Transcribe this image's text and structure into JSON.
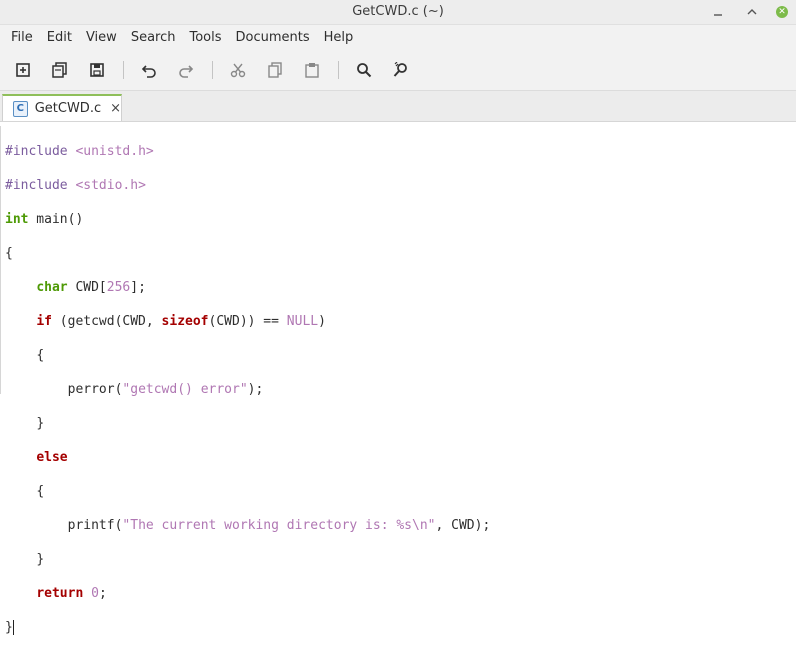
{
  "window": {
    "title": "GetCWD.c (~)"
  },
  "menu": [
    "File",
    "Edit",
    "View",
    "Search",
    "Tools",
    "Documents",
    "Help"
  ],
  "toolbar": {
    "buttons": [
      "new-document",
      "open-document",
      "save",
      "undo",
      "redo",
      "cut",
      "copy",
      "paste",
      "find",
      "find-replace"
    ]
  },
  "tab": {
    "label": "GetCWD.c",
    "icon": "C",
    "close": "×"
  },
  "code": {
    "include1_kw": "#include",
    "include1_val": "<unistd.h>",
    "include2_kw": "#include",
    "include2_val": "<stdio.h>",
    "main_type": "int",
    "main_rest": " main()",
    "open_brace": "{",
    "char_kw": "char",
    "cwd_decl": " CWD[",
    "size": "256",
    "cwd_end": "];",
    "if_kw": "if",
    "if_mid": " (getcwd(CWD, ",
    "sizeof_kw": "sizeof",
    "if_cmp": "(CWD)) == ",
    "null": "NULL",
    "if_end": ")",
    "inner_open1": "{",
    "perror_call": "perror(",
    "perror_str": "\"getcwd() error\"",
    "perror_end": ");",
    "inner_close1": "}",
    "else_kw": "else",
    "inner_open2": "{",
    "printf_call": "printf(",
    "printf_str": "\"The current working directory is: %s\\n\"",
    "printf_end": ", CWD);",
    "inner_close2": "}",
    "return_kw": "return",
    "zero": "0",
    "semi": ";",
    "close_brace": "}"
  }
}
